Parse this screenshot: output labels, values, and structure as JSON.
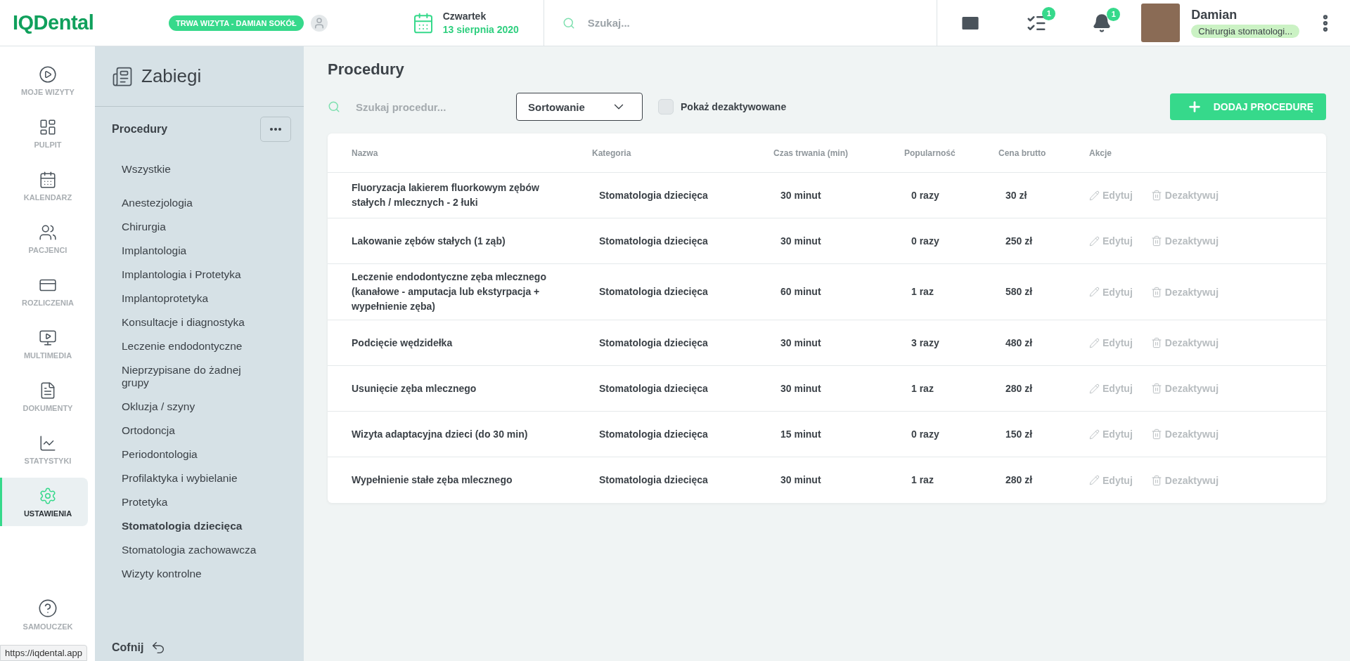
{
  "header": {
    "logo": "IQDental",
    "visit_badge": "TRWA WIZYTA - DAMIAN SOKÓŁ",
    "day": "Czwartek",
    "date": "13 sierpnia 2020",
    "search": {
      "placeholder": "Szukaj..."
    },
    "tasks_count": "1",
    "notifications_count": "1",
    "user": {
      "name": "Damian",
      "role": "Chirurgia stomatologi..."
    }
  },
  "nav": [
    {
      "label": "MOJE WIZYTY",
      "selected": false
    },
    {
      "label": "PULPIT",
      "selected": false
    },
    {
      "label": "KALENDARZ",
      "selected": false
    },
    {
      "label": "PACJENCI",
      "selected": false
    },
    {
      "label": "ROZLICZENIA",
      "selected": false
    },
    {
      "label": "MULTIMEDIA",
      "selected": false
    },
    {
      "label": "DOKUMENTY",
      "selected": false
    },
    {
      "label": "STATYSTYKI",
      "selected": false
    },
    {
      "label": "USTAWIENIA",
      "selected": true
    }
  ],
  "help": {
    "label": "SAMOUCZEK"
  },
  "sidebar": {
    "title": "Zabiegi",
    "section": "Procedury",
    "all": "Wszystkie",
    "back": "Cofnij",
    "items": [
      {
        "label": "Anestezjologia",
        "selected": false
      },
      {
        "label": "Chirurgia",
        "selected": false
      },
      {
        "label": "Implantologia",
        "selected": false
      },
      {
        "label": "Implantologia i Protetyka",
        "selected": false
      },
      {
        "label": "Implantoprotetyka",
        "selected": false
      },
      {
        "label": "Konsultacje i diagnostyka",
        "selected": false
      },
      {
        "label": "Leczenie endodontyczne",
        "selected": false
      },
      {
        "label": "Nieprzypisane do żadnej grupy",
        "selected": false
      },
      {
        "label": "Okluzja / szyny",
        "selected": false
      },
      {
        "label": "Ortodoncja",
        "selected": false
      },
      {
        "label": "Periodontologia",
        "selected": false
      },
      {
        "label": "Profilaktyka i wybielanie",
        "selected": false
      },
      {
        "label": "Protetyka",
        "selected": false
      },
      {
        "label": "Stomatologia dziecięca",
        "selected": true
      },
      {
        "label": "Stomatologia zachowawcza",
        "selected": false
      },
      {
        "label": "Wizyty kontrolne",
        "selected": false
      }
    ]
  },
  "main": {
    "title": "Procedury",
    "search": {
      "placeholder": "Szukaj procedur..."
    },
    "sort": "Sortowanie",
    "show_deactivated": {
      "label": "Pokaż dezaktywowane",
      "checked": false
    },
    "add_button": "DODAJ PROCEDURĘ"
  },
  "table": {
    "columns": [
      "Nazwa",
      "Kategoria",
      "Czas trwania (min)",
      "Popularność",
      "Cena brutto",
      "Akcje"
    ],
    "rows": [
      {
        "name": "Fluoryzacja lakierem fluorkowym zębów stałych / mlecznych - 2 łuki",
        "category": "Stomatologia dziecięca",
        "duration": "30 minut",
        "popularity": "0 razy",
        "price": "30 zł",
        "edit": "Edytuj",
        "deactivate": "Dezaktywuj"
      },
      {
        "name": "Lakowanie zębów stałych (1 ząb)",
        "category": "Stomatologia dziecięca",
        "duration": "30 minut",
        "popularity": "0 razy",
        "price": "250 zł",
        "edit": "Edytuj",
        "deactivate": "Dezaktywuj"
      },
      {
        "name": "Leczenie endodontyczne zęba mlecznego (kanałowe - amputacja lub ekstyrpacja + wypełnienie zęba)",
        "category": "Stomatologia dziecięca",
        "duration": "60 minut",
        "popularity": "1 raz",
        "price": "580 zł",
        "edit": "Edytuj",
        "deactivate": "Dezaktywuj"
      },
      {
        "name": "Podcięcie wędzidełka",
        "category": "Stomatologia dziecięca",
        "duration": "30 minut",
        "popularity": "3 razy",
        "price": "480 zł",
        "edit": "Edytuj",
        "deactivate": "Dezaktywuj"
      },
      {
        "name": "Usunięcie zęba mlecznego",
        "category": "Stomatologia dziecięca",
        "duration": "30 minut",
        "popularity": "1 raz",
        "price": "280 zł",
        "edit": "Edytuj",
        "deactivate": "Dezaktywuj"
      },
      {
        "name": "Wizyta adaptacyjna dzieci (do 30 min)",
        "category": "Stomatologia dziecięca",
        "duration": "15 minut",
        "popularity": "0 razy",
        "price": "150 zł",
        "edit": "Edytuj",
        "deactivate": "Dezaktywuj"
      },
      {
        "name": "Wypełnienie stałe zęba mlecznego",
        "category": "Stomatologia dziecięca",
        "duration": "30 minut",
        "popularity": "1 raz",
        "price": "280 zł",
        "edit": "Edytuj",
        "deactivate": "Dezaktywuj"
      }
    ]
  },
  "status_bar": {
    "url": "https://iqdental.app"
  }
}
